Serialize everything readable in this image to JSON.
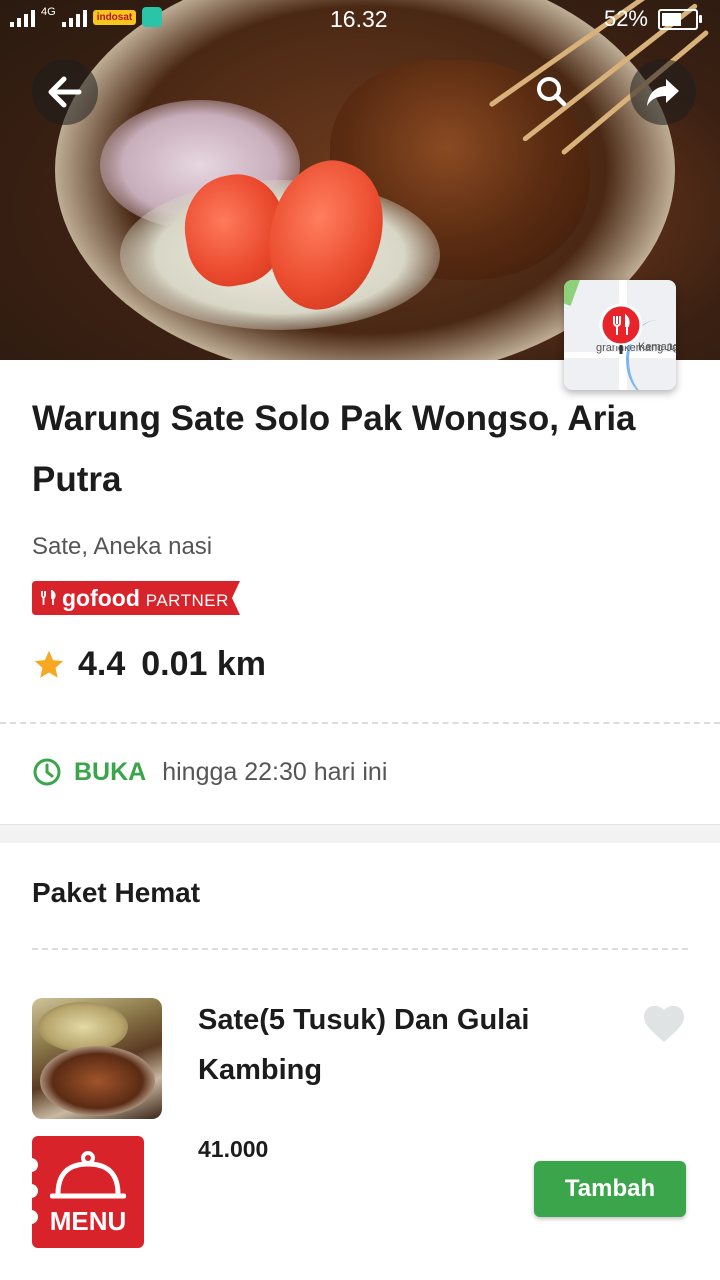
{
  "status_bar": {
    "time": "16.32",
    "battery_percent": "52%",
    "battery_level": 0.52,
    "network": "4G",
    "carrier_badge": "indosat"
  },
  "header": {
    "back_icon": "arrow-left-icon",
    "search_icon": "search-icon",
    "share_icon": "share-icon"
  },
  "map": {
    "label_1": "Kemang",
    "label_2": "grandkemang Ja"
  },
  "restaurant": {
    "name": "Warung Sate Solo Pak Wongso, Aria Putra",
    "cuisine": "Sate, Aneka nasi",
    "badge_brand": "gofood",
    "badge_partner": "PARTNER",
    "rating": "4.4",
    "distance": "0.01 km"
  },
  "hours": {
    "status": "BUKA",
    "detail": "hingga 22:30 hari ini"
  },
  "section": {
    "title": "Paket Hemat"
  },
  "items": [
    {
      "name": "Sate(5 Tusuk) Dan Gulai Kambing",
      "price": "41.000",
      "add_label": "Tambah"
    }
  ],
  "menu_button": {
    "label": "MENU"
  },
  "colors": {
    "brand_green": "#3aa54a",
    "gofood_red": "#d8232a",
    "star": "#f7a823"
  }
}
